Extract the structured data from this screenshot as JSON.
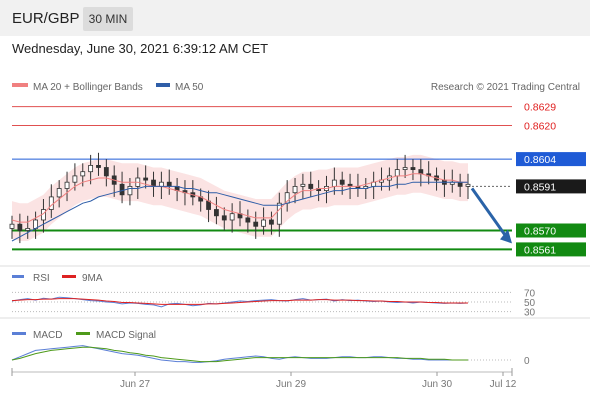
{
  "header": {
    "pair": "EUR/GBP",
    "timeframe": "30 MIN"
  },
  "datetime": "Wednesday, June 30, 2021 6:39:12 AM CET",
  "legend": {
    "bb": "MA 20 + Bollinger Bands",
    "ma50": "MA 50",
    "credit": "Research © 2021 Trading Central"
  },
  "rsi_legend": {
    "rsi": "RSI",
    "ma": "9MA"
  },
  "macd_legend": {
    "macd": "MACD",
    "signal": "MACD Signal"
  },
  "colors": {
    "bb": "#f08080",
    "ma50": "#2f5ea8",
    "resistance": "#e05050",
    "pivot": "#1f5bd6",
    "support": "#128a12",
    "candle": "#333333",
    "band_fill": "#fbe3e3",
    "arrow": "#2a63a8",
    "rsi": "#5b7fd6",
    "rsi_ma": "#dd2222",
    "macd": "#5b7fd6",
    "macd_signal": "#4e9a1a"
  },
  "chart_data": [
    {
      "type": "candlestick",
      "ylim": [
        0.8555,
        0.8635
      ],
      "levels": [
        {
          "value": 0.8629,
          "label": "0.8629",
          "kind": "resistance"
        },
        {
          "value": 0.862,
          "label": "0.8620",
          "kind": "resistance"
        },
        {
          "value": 0.8604,
          "label": "0.8604",
          "kind": "pivot"
        },
        {
          "value": 0.8591,
          "label": "0.8591",
          "kind": "last"
        },
        {
          "value": 0.857,
          "label": "0.8570",
          "kind": "support"
        },
        {
          "value": 0.8561,
          "label": "0.8561",
          "kind": "support"
        }
      ],
      "close": [
        0.8573,
        0.857,
        0.8571,
        0.8575,
        0.858,
        0.8586,
        0.859,
        0.8593,
        0.8596,
        0.8598,
        0.8601,
        0.86,
        0.8596,
        0.8592,
        0.8587,
        0.8591,
        0.8595,
        0.8594,
        0.8591,
        0.8593,
        0.8591,
        0.8589,
        0.8588,
        0.8586,
        0.8584,
        0.858,
        0.8577,
        0.8575,
        0.8578,
        0.8576,
        0.8574,
        0.8572,
        0.8575,
        0.8573,
        0.8583,
        0.8588,
        0.8591,
        0.8592,
        0.859,
        0.8589,
        0.8591,
        0.8594,
        0.8592,
        0.8591,
        0.859,
        0.8591,
        0.8593,
        0.8594,
        0.8596,
        0.8599,
        0.86,
        0.8599,
        0.8597,
        0.8596,
        0.8594,
        0.8592,
        0.8593,
        0.8591,
        0.8592
      ],
      "ma20": [
        0.8575,
        0.8574,
        0.8574,
        0.8576,
        0.8578,
        0.8582,
        0.8585,
        0.8588,
        0.8591,
        0.8593,
        0.8594,
        0.8595,
        0.8595,
        0.8594,
        0.8593,
        0.8593,
        0.8593,
        0.8592,
        0.8591,
        0.8591,
        0.859,
        0.8589,
        0.8588,
        0.8587,
        0.8586,
        0.8584,
        0.8582,
        0.858,
        0.8579,
        0.8578,
        0.8577,
        0.8576,
        0.8576,
        0.8576,
        0.858,
        0.8584,
        0.8587,
        0.8589,
        0.8589,
        0.859,
        0.859,
        0.8591,
        0.8591,
        0.8591,
        0.8591,
        0.8592,
        0.8593,
        0.8594,
        0.8595,
        0.8596,
        0.8596,
        0.8597,
        0.8597,
        0.8596,
        0.8595,
        0.8594,
        0.8594,
        0.8593,
        0.8593
      ],
      "ma50": [
        0.8565,
        0.8567,
        0.8569,
        0.8571,
        0.8573,
        0.8575,
        0.8577,
        0.8579,
        0.8581,
        0.8583,
        0.8584,
        0.8586,
        0.8587,
        0.8588,
        0.8589,
        0.859,
        0.859,
        0.8591,
        0.8591,
        0.8591,
        0.8591,
        0.8591,
        0.859,
        0.859,
        0.8589,
        0.8588,
        0.8588,
        0.8587,
        0.8586,
        0.8585,
        0.8584,
        0.8583,
        0.8582,
        0.8582,
        0.8582,
        0.8583,
        0.8584,
        0.8585,
        0.8586,
        0.8587,
        0.8588,
        0.8589,
        0.8589,
        0.859,
        0.859,
        0.859,
        0.8591,
        0.8591,
        0.8591,
        0.8592,
        0.8592,
        0.8593,
        0.8593,
        0.8593,
        0.8593,
        0.8593,
        0.8593,
        0.8593,
        0.8593
      ],
      "band_width": 0.0009,
      "forecast": {
        "from": 0.8591,
        "to": 0.8561
      }
    },
    {
      "type": "line",
      "name": "RSI",
      "ticks": [
        "70",
        "50",
        "30"
      ],
      "ylim": [
        25,
        75
      ],
      "rsi": [
        52,
        55,
        57,
        54,
        58,
        56,
        60,
        59,
        57,
        55,
        53,
        52,
        50,
        49,
        46,
        48,
        47,
        45,
        44,
        40,
        46,
        47,
        45,
        42,
        44,
        47,
        46,
        48,
        50,
        52,
        51,
        53,
        54,
        55,
        53,
        52,
        55,
        57,
        54,
        55,
        56,
        52,
        55,
        53,
        54,
        52,
        51,
        52,
        50,
        49,
        50,
        48,
        50,
        49,
        48,
        47,
        48,
        47,
        48
      ],
      "rsi_ma": [
        53,
        54,
        55,
        55,
        56,
        56,
        57,
        57,
        57,
        56,
        55,
        54,
        52,
        51,
        49,
        49,
        48,
        47,
        46,
        45,
        45,
        45,
        45,
        45,
        45,
        46,
        46,
        47,
        48,
        49,
        50,
        51,
        52,
        53,
        53,
        53,
        54,
        54,
        54,
        55,
        55,
        54,
        54,
        54,
        53,
        53,
        52,
        52,
        51,
        51,
        50,
        50,
        50,
        49,
        49,
        48,
        48,
        48,
        48
      ]
    },
    {
      "type": "line",
      "name": "MACD",
      "ticks": [
        "0"
      ],
      "ylim": [
        -0.001,
        0.0025
      ],
      "macd": [
        0.0,
        0.0004,
        0.0008,
        0.0012,
        0.0013,
        0.0014,
        0.0015,
        0.0016,
        0.0017,
        0.0018,
        0.0016,
        0.0014,
        0.0012,
        0.001,
        0.0008,
        0.0007,
        0.0006,
        0.0004,
        0.0002,
        0.0,
        -0.0001,
        -0.0002,
        -0.0002,
        -0.0003,
        -0.0003,
        -0.0002,
        -0.0001,
        0.0001,
        0.0002,
        0.0003,
        0.0004,
        0.0005,
        0.0004,
        0.0002,
        0.0001,
        0.0003,
        0.0004,
        0.0003,
        0.0002,
        0.0002,
        0.0002,
        0.0003,
        0.0004,
        0.0004,
        0.0003,
        0.0003,
        0.0004,
        0.0004,
        0.0003,
        0.0002,
        0.0002,
        0.0001,
        0.0001,
        0.0,
        0.0,
        0.0,
        0.0,
        0.0,
        0.0
      ],
      "signal": [
        0.0,
        0.0002,
        0.0005,
        0.0008,
        0.001,
        0.0012,
        0.0013,
        0.0014,
        0.0015,
        0.0016,
        0.0016,
        0.0015,
        0.0014,
        0.0012,
        0.0011,
        0.0009,
        0.0008,
        0.0006,
        0.0005,
        0.0003,
        0.0002,
        0.0001,
        0.0,
        -0.0001,
        -0.0002,
        -0.0002,
        -0.0002,
        -0.0001,
        0.0,
        0.0001,
        0.0002,
        0.0003,
        0.0003,
        0.0003,
        0.0003,
        0.0003,
        0.0003,
        0.0003,
        0.0003,
        0.0003,
        0.0003,
        0.0003,
        0.0003,
        0.0003,
        0.0003,
        0.0003,
        0.0003,
        0.0003,
        0.0003,
        0.0003,
        0.0002,
        0.0002,
        0.0002,
        0.0001,
        0.0001,
        0.0001,
        0.0,
        0.0,
        0.0
      ]
    }
  ],
  "x_ticks": [
    "Jun 27",
    "Jun 29",
    "Jun 30",
    "Jul 12"
  ]
}
